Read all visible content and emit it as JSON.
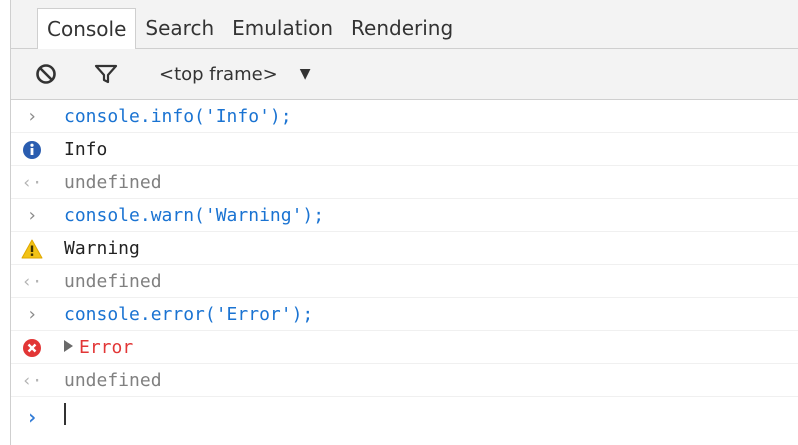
{
  "tabs": [
    {
      "label": "Console",
      "active": true
    },
    {
      "label": "Search",
      "active": false
    },
    {
      "label": "Emulation",
      "active": false
    },
    {
      "label": "Rendering",
      "active": false
    }
  ],
  "toolbar": {
    "clear_icon": "clear-console-icon",
    "filter_icon": "filter-icon",
    "frame_selector": "<top frame>",
    "frame_caret": "▼"
  },
  "messages": [
    {
      "type": "input",
      "glyph": "›",
      "text": "console.info('Info');"
    },
    {
      "type": "info",
      "icon": "info-icon",
      "text": "Info"
    },
    {
      "type": "result",
      "glyph": "‹·",
      "text": "undefined"
    },
    {
      "type": "input",
      "glyph": "›",
      "text": "console.warn('Warning');"
    },
    {
      "type": "warning",
      "icon": "warning-icon",
      "text": "Warning"
    },
    {
      "type": "result",
      "glyph": "‹·",
      "text": "undefined"
    },
    {
      "type": "input",
      "glyph": "›",
      "text": "console.error('Error');"
    },
    {
      "type": "error",
      "icon": "error-icon",
      "text": "Error"
    },
    {
      "type": "result",
      "glyph": "‹·",
      "text": "undefined"
    }
  ],
  "prompt": {
    "glyph": "›",
    "value": ""
  },
  "colors": {
    "input": "#1a73d2",
    "error": "#e23636",
    "info": "#2a5db0",
    "warning": "#f2c316",
    "result": "#808080"
  }
}
